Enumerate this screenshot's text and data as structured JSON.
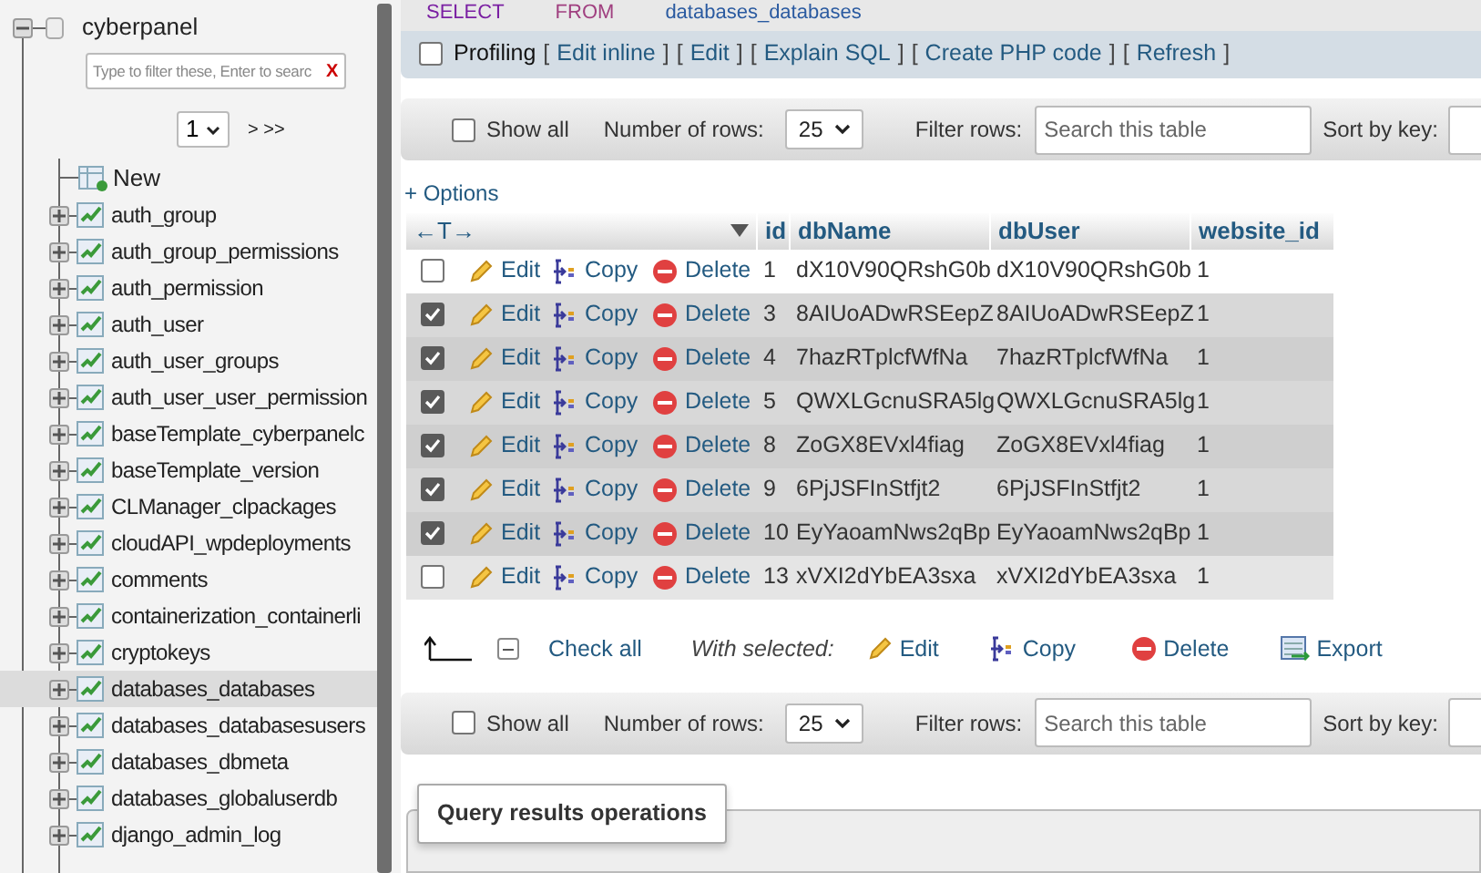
{
  "sidebar": {
    "database": "cyberpanel",
    "filter_placeholder": "Type to filter these, Enter to searc",
    "filter_clear": "X",
    "page_select": "1",
    "page_nav": "> >>",
    "new_label": "New",
    "tables": [
      {
        "name": "auth_group",
        "selected": false
      },
      {
        "name": "auth_group_permissions",
        "selected": false
      },
      {
        "name": "auth_permission",
        "selected": false
      },
      {
        "name": "auth_user",
        "selected": false
      },
      {
        "name": "auth_user_groups",
        "selected": false
      },
      {
        "name": "auth_user_user_permission",
        "selected": false
      },
      {
        "name": "baseTemplate_cyberpanelc",
        "selected": false
      },
      {
        "name": "baseTemplate_version",
        "selected": false
      },
      {
        "name": "CLManager_clpackages",
        "selected": false
      },
      {
        "name": "cloudAPI_wpdeployments",
        "selected": false
      },
      {
        "name": "comments",
        "selected": false
      },
      {
        "name": "containerization_containerli",
        "selected": false
      },
      {
        "name": "cryptokeys",
        "selected": false
      },
      {
        "name": "databases_databases",
        "selected": true
      },
      {
        "name": "databases_databasesusers",
        "selected": false
      },
      {
        "name": "databases_dbmeta",
        "selected": false
      },
      {
        "name": "databases_globaluserdb",
        "selected": false
      },
      {
        "name": "django_admin_log",
        "selected": false
      }
    ]
  },
  "sql": {
    "keyword_1": "SELECT",
    "keyword_2": "FROM",
    "table": "databases_databases"
  },
  "profiling": {
    "label": "Profiling",
    "checked": false,
    "links": [
      {
        "open": "[",
        "label": "Edit inline",
        "close": "]"
      },
      {
        "open": "[",
        "label": "Edit",
        "close": "]"
      },
      {
        "open": "[",
        "label": "Explain SQL",
        "close": "]"
      },
      {
        "open": "[",
        "label": "Create PHP code",
        "close": "]"
      },
      {
        "open": "[",
        "label": "Refresh",
        "close": "]"
      }
    ]
  },
  "navbars": [
    {
      "show_all": "Show all",
      "show_all_checked": false,
      "rows_label": "Number of rows:",
      "rows_value": "25",
      "filter_label": "Filter rows:",
      "filter_placeholder": "Search this table",
      "sort_label": "Sort by key:"
    },
    {
      "show_all": "Show all",
      "show_all_checked": false,
      "rows_label": "Number of rows:",
      "rows_value": "25",
      "filter_label": "Filter rows:",
      "filter_placeholder": "Search this table",
      "sort_label": "Sort by key:"
    }
  ],
  "options": "+ Options",
  "column_arrows": "←T→",
  "table": {
    "columns": [
      "id",
      "dbName",
      "dbUser",
      "website_id"
    ],
    "rows": [
      {
        "selected": false,
        "actions": [
          "Edit",
          "Copy",
          "Delete"
        ],
        "cells": [
          "1",
          "dX10V90QRshG0b",
          "dX10V90QRshG0b",
          "1"
        ]
      },
      {
        "selected": true,
        "actions": [
          "Edit",
          "Copy",
          "Delete"
        ],
        "cells": [
          "3",
          "8AIUoADwRSEepZ",
          "8AIUoADwRSEepZ",
          "1"
        ]
      },
      {
        "selected": true,
        "actions": [
          "Edit",
          "Copy",
          "Delete"
        ],
        "cells": [
          "4",
          "7hazRTplcfWfNa",
          "7hazRTplcfWfNa",
          "1"
        ]
      },
      {
        "selected": true,
        "actions": [
          "Edit",
          "Copy",
          "Delete"
        ],
        "cells": [
          "5",
          "QWXLGcnuSRA5lg",
          "QWXLGcnuSRA5lg",
          "1"
        ]
      },
      {
        "selected": true,
        "actions": [
          "Edit",
          "Copy",
          "Delete"
        ],
        "cells": [
          "8",
          "ZoGX8EVxl4fiag",
          "ZoGX8EVxl4fiag",
          "1"
        ]
      },
      {
        "selected": true,
        "actions": [
          "Edit",
          "Copy",
          "Delete"
        ],
        "cells": [
          "9",
          "6PjJSFInStfjt2",
          "6PjJSFInStfjt2",
          "1"
        ]
      },
      {
        "selected": true,
        "actions": [
          "Edit",
          "Copy",
          "Delete"
        ],
        "cells": [
          "10",
          "EyYaoamNws2qBp",
          "EyYaoamNws2qBp",
          "1"
        ]
      },
      {
        "selected": false,
        "actions": [
          "Edit",
          "Copy",
          "Delete"
        ],
        "cells": [
          "13",
          "xVXI2dYbEA3sxa",
          "xVXI2dYbEA3sxa",
          "1"
        ]
      }
    ]
  },
  "bulk": {
    "check_all": "Check all",
    "with_selected": "With selected:",
    "actions": [
      {
        "kind": "edit",
        "label": "Edit"
      },
      {
        "kind": "copy",
        "label": "Copy"
      },
      {
        "kind": "delete",
        "label": "Delete"
      },
      {
        "kind": "export",
        "label": "Export"
      }
    ]
  },
  "operations_title": "Query results operations"
}
